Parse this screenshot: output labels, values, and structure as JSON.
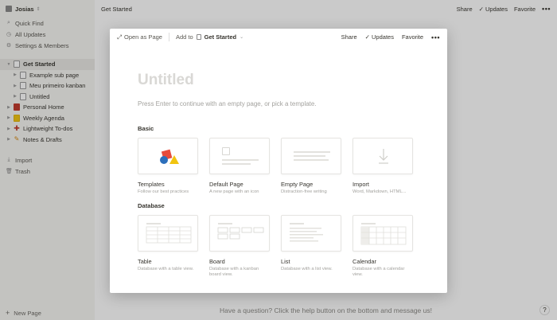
{
  "sidebar": {
    "workspace": "Josias",
    "nav": [
      {
        "label": "Quick Find",
        "icon": "search-icon"
      },
      {
        "label": "All Updates",
        "icon": "clock-icon"
      },
      {
        "label": "Settings & Members",
        "icon": "gear-icon"
      }
    ],
    "pages": [
      {
        "label": "Get Started",
        "level": 0,
        "selected": true
      },
      {
        "label": "Example sub page",
        "level": 1
      },
      {
        "label": "Meu primeiro kanban",
        "level": 1
      },
      {
        "label": "Untitled",
        "level": 1
      },
      {
        "label": "Personal Home",
        "level": 0,
        "color": "red"
      },
      {
        "label": "Weekly Agenda",
        "level": 0,
        "color": "yellow"
      },
      {
        "label": "Lightweight To-dos",
        "level": 0,
        "color": "plus"
      },
      {
        "label": "Notes & Drafts",
        "level": 0,
        "color": "pencil"
      }
    ],
    "bottom": [
      {
        "label": "Import",
        "icon": "download-icon"
      },
      {
        "label": "Trash",
        "icon": "trash-icon"
      }
    ],
    "new_page": "New Page"
  },
  "topbar": {
    "title": "Get Started",
    "share": "Share",
    "updates": "Updates",
    "favorite": "Favorite"
  },
  "help_message": "Have a question? Click the help button on the bottom and message us!",
  "help_button": "?",
  "modal": {
    "open_as_page": "Open as Page",
    "add_to": "Add to",
    "add_to_target": "Get Started",
    "share": "Share",
    "updates": "Updates",
    "favorite": "Favorite",
    "more": "•••",
    "title_placeholder": "Untitled",
    "hint": "Press Enter to continue with an empty page, or pick a template.",
    "basic_label": "Basic",
    "basic": [
      {
        "name": "Templates",
        "desc": "Follow our best practices"
      },
      {
        "name": "Default Page",
        "desc": "A new page with an icon"
      },
      {
        "name": "Empty Page",
        "desc": "Distraction-free writing"
      },
      {
        "name": "Import",
        "desc": "Word, Markdown, HTML..."
      }
    ],
    "database_label": "Database",
    "database": [
      {
        "name": "Table",
        "desc": "Database with a table view."
      },
      {
        "name": "Board",
        "desc": "Database with a kanban board view."
      },
      {
        "name": "List",
        "desc": "Database with a list view."
      },
      {
        "name": "Calendar",
        "desc": "Database with a calendar view."
      }
    ]
  },
  "colors": {
    "sidebar_bg": "#f7f6f3",
    "overlay": "rgba(15,15,15,0.22)",
    "text": "#37352f",
    "muted": "#a3a29e"
  }
}
